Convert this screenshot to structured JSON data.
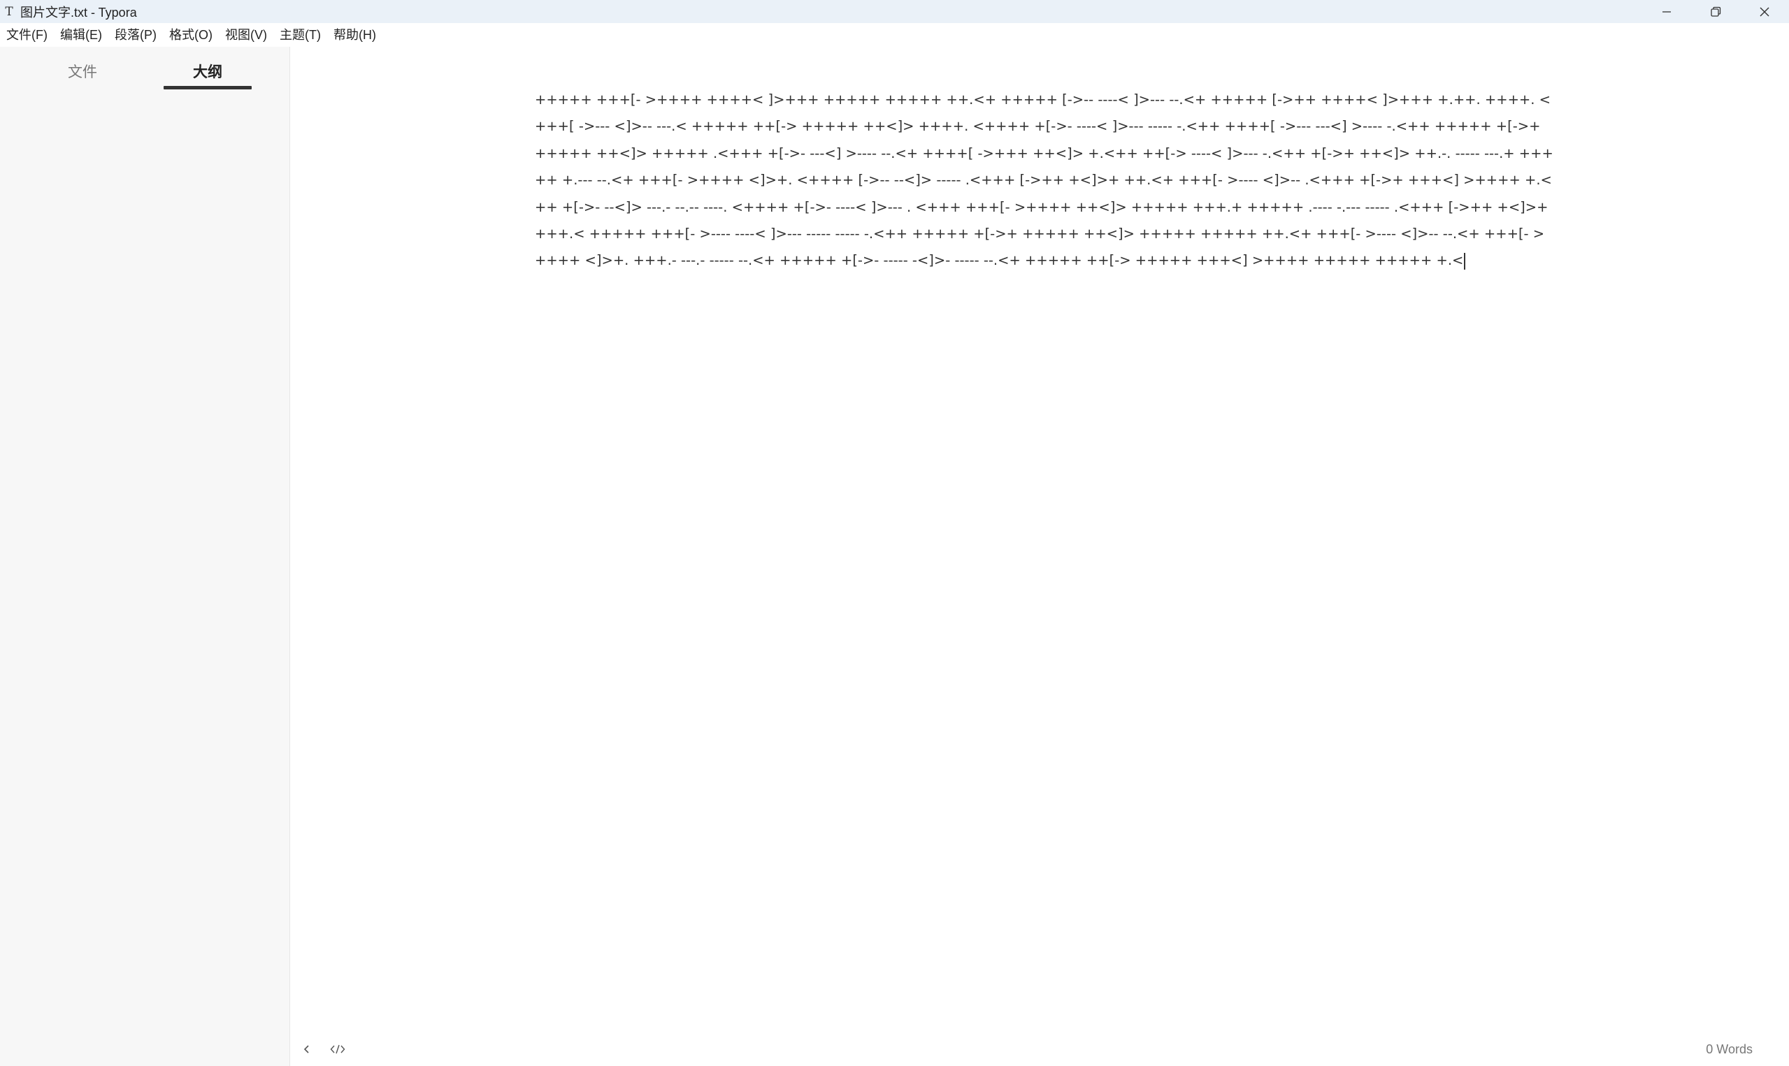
{
  "window": {
    "app_icon": "T",
    "title": "图片文字.txt - Typora"
  },
  "window_controls": {
    "icons": [
      "minimize-icon",
      "restore-icon",
      "close-icon"
    ]
  },
  "menubar": {
    "items": [
      {
        "label": "文件(F)"
      },
      {
        "label": "编辑(E)"
      },
      {
        "label": "段落(P)"
      },
      {
        "label": "格式(O)"
      },
      {
        "label": "视图(V)"
      },
      {
        "label": "主题(T)"
      },
      {
        "label": "帮助(H)"
      }
    ]
  },
  "sidebar": {
    "tabs": [
      {
        "label": "文件",
        "active": false
      },
      {
        "label": "大纲",
        "active": true
      }
    ]
  },
  "editor": {
    "content": "+++++ +++[- >++++ ++++< ]>+++ +++++ +++++ ++.<+ +++++ [->-- ----< ]>--- --.<+ +++++ [->++ ++++< ]>+++ +.++. ++++. <+++[ ->--- <]>-- ---.< +++++ ++[-> +++++ ++<]> ++++. <++++ +[->- ----< ]>--- ----- -.<++ ++++[ ->--- ---<] >---- -.<++ +++++ +[->+ +++++ ++<]> +++++ .<+++ +[->- ---<] >---- --.<+ ++++[ ->+++ ++<]> +.<++ ++[-> ----< ]>--- -.<++ +[->+ ++<]> ++.-. ----- ---.+ +++++ +.--- --.<+ +++[- >++++ <]>+. <++++ [->-- --<]> ----- .<+++ [->++ +<]>+ ++.<+ +++[- >---- <]>-- .<+++ +[->+ +++<] >++++ +.<++ +[->- --<]> ---.- --.-- ----. <++++ +[->- ----< ]>--- . <+++ +++[- >++++ ++<]> +++++ +++.+ +++++ .---- -.--- ----- .<+++ [->++ +<]>+ +++.< +++++ +++[- >---- ----< ]>--- ----- ----- -.<++ +++++ +[->+ +++++ ++<]> +++++ +++++ ++.<+ +++[- >---- <]>-- --.<+ +++[- >++++ <]>+. +++.- ---.- ----- --.<+ +++++ +[->- ----- -<]>- ----- --.<+ +++++ ++[-> +++++ +++<] >++++ +++++ +++++ +.<"
  },
  "statusbar": {
    "back_icon": "chevron-left-icon",
    "source_icon": "code-icon",
    "word_count": "0 Words"
  }
}
